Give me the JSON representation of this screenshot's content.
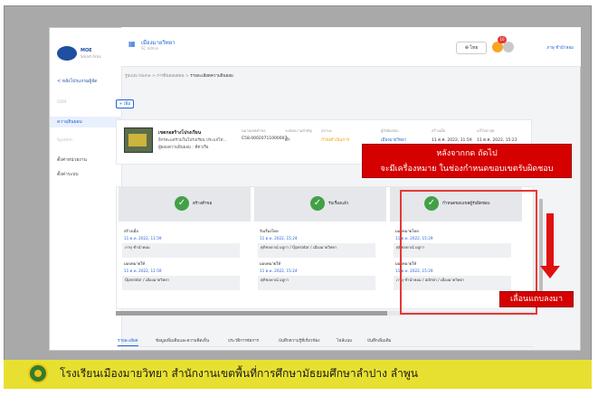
{
  "nav": {
    "logo_text": "MOE",
    "logo_sub": "Smart Area",
    "back_label": "< หลังโปรแกรมผู้จัด",
    "sec1": "CRM",
    "item_active": "ความยินยอม",
    "sec2": "System",
    "item2": "ตั้งค่าหน่วยงาน",
    "item3": "ตั้งค่าระบบ"
  },
  "header": {
    "title": "เมืองมายวิทยา",
    "sub": "SC Admin",
    "btn": "⊕ ไทย",
    "badge": "10",
    "user": "ภาษุ ชำนำหอม"
  },
  "crumbs": {
    "text": "รูปแบบ Home > การยินยอมต่อน > ",
    "current": "รายละเอียดความยินยอม"
  },
  "add_label": "+ เพิ่ม",
  "card": {
    "title": "เขตกอสร้างโปรงเรียน",
    "sub": "อิกรสะแต่ร่วมในโปรงเรียน ประแจ่ไท่...",
    "sub2": "ผู้ยอมความยินยอม : ที่ตัวเรือ",
    "cols": [
      {
        "h": "หมายเลขคำขอ",
        "v": "C58.00020711000007",
        "cls": ""
      },
      {
        "h": "ระดับความสำคัญ",
        "v": "ต่ำ",
        "cls": ""
      },
      {
        "h": "สถานะ",
        "v": "กำลังดำเนินการ",
        "cls": "orange"
      },
      {
        "h": "ผู้รับผิดชอบ",
        "v": "เมืองมายวิทยา",
        "cls": "blue"
      },
      {
        "h": "สร้างเมื่อ",
        "v": "11 ต.ค. 2022, 11:59",
        "cls": ""
      },
      {
        "h": "แก้ไขล่าสุด",
        "v": "11 ต.ค. 2022, 15:23",
        "cls": ""
      }
    ]
  },
  "steps": [
    {
      "label": "สร้างคำขอ",
      "ev": [
        {
          "t": "สร้างเมื่อ",
          "cls": ""
        },
        {
          "t": "11 ต.ค. 2022, 11:59",
          "cls": "blue"
        },
        {
          "t": "ภาษุ ชำนำหอม",
          "cls": "box"
        },
        {
          "t": "มอบหมายให้",
          "cls": ""
        },
        {
          "t": "11 ต.ค. 2022, 11:59",
          "cls": "blue"
        },
        {
          "t": "Operator / เมืองมายวิทยา",
          "cls": "box"
        }
      ]
    },
    {
      "label": "รับเรื่องแล้ว",
      "ev": [
        {
          "t": "รับเรื่องโดย",
          "cls": ""
        },
        {
          "t": "11 ต.ค. 2022, 15:24",
          "cls": "blue"
        },
        {
          "t": "ศุภิชลดาณ์ ผลูกา / Operator / เมืองมายวิทยา",
          "cls": "box"
        },
        {
          "t": "มอบหมายให้",
          "cls": ""
        },
        {
          "t": "11 ต.ค. 2022, 15:24",
          "cls": "blue"
        },
        {
          "t": "ศุภิชลดาณ์ ผลูกา",
          "cls": "box"
        }
      ]
    },
    {
      "label": "กำหนดขอบเขตผู้รับผิดชอบ",
      "ev": [
        {
          "t": "มอบหมายโดย",
          "cls": ""
        },
        {
          "t": "11 ต.ค. 2022, 15:29",
          "cls": "blue"
        },
        {
          "t": "ศุภิชลดาณ์ ผลูกา",
          "cls": "box"
        },
        {
          "t": "มอบหมายให้",
          "cls": ""
        },
        {
          "t": "11 ต.ค. 2022, 15:29",
          "cls": "blue"
        },
        {
          "t": "ภาษุ ชำนำหอม / admin / เมืองมายวิทยา",
          "cls": "box"
        }
      ]
    }
  ],
  "tabs": [
    "รายละเอียด",
    "ข้อมูลเพิ่มเติมและความคิดเห็น",
    "ประวัติการจัดการ",
    "บันทึกความรู้ที่เกี่ยวข้อง",
    "ไฟล์แนบ",
    "บันทึกเพิ่มเติม"
  ],
  "annotation1_l1": "หลังจากกด ถัดไป",
  "annotation1_l2": "จะมีเครื่องหมาย ในช่องกำหนดขอบเขตรับผิดชอบ",
  "annotation2": "เลื่อนแถบลงมา",
  "footer_text": "โรงเรียนเมืองมายวิทยา สำนักงานเขตพื้นที่การศึกษามัธยมศึกษาลำปาง ลำพูน",
  "colors": {
    "accent": "#1e63d6",
    "annotation": "#d50000",
    "banner": "#e8e030",
    "check": "#43a047"
  }
}
